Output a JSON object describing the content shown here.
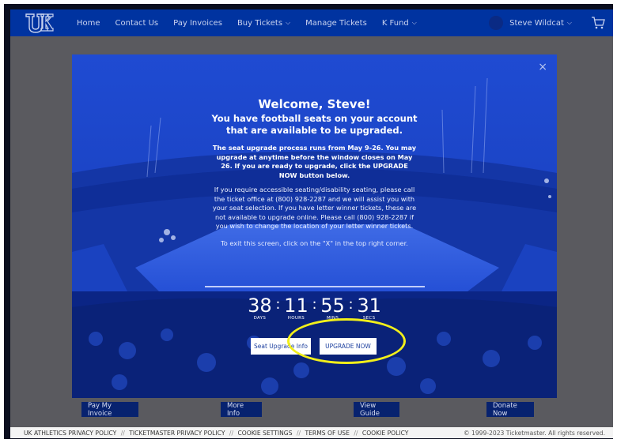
{
  "nav": {
    "items": [
      {
        "label": "Home",
        "dropdown": false
      },
      {
        "label": "Contact Us",
        "dropdown": false
      },
      {
        "label": "Pay Invoices",
        "dropdown": false
      },
      {
        "label": "Buy Tickets",
        "dropdown": true
      },
      {
        "label": "Manage Tickets",
        "dropdown": false
      },
      {
        "label": "K Fund",
        "dropdown": true
      }
    ],
    "user_name": "Steve Wildcat",
    "chevron": "⌵"
  },
  "modal": {
    "close": "×",
    "welcome": "Welcome, Steve!",
    "available": "You have football seats on your account that are available to be upgraded.",
    "para1": "The seat upgrade process runs from May 9-26. You may upgrade at anytime before the window closes on May 26. If you are ready to upgrade, click the UPGRADE NOW button below.",
    "para2": "If you require accessible seating/disability seating, please call the ticket office at (800) 928-2287 and we will assist you with your seat selection. If you have letter winner tickets, these are not available to upgrade online. Please call (800) 928-2287 if you wish to change the location of your letter winner tickets.",
    "para3": "To exit this screen, click on the \"X\" in the top right corner.",
    "countdown": {
      "days": "38",
      "days_label": "DAYS",
      "hours": "11",
      "hours_label": "HOURS",
      "mins": "55",
      "mins_label": "MINS",
      "secs": "31",
      "secs_label": "SECS",
      "separator": ":"
    },
    "seat_info_button": "Seat Upgrade Info",
    "upgrade_button": "UPGRADE NOW"
  },
  "bottom_buttons": [
    "Pay My Invoice",
    "More Info",
    "View Guide",
    "Donate Now"
  ],
  "footer": {
    "links": [
      "UK ATHLETICS PRIVACY POLICY",
      "TICKETMASTER PRIVACY POLICY",
      "COOKIE SETTINGS",
      "TERMS OF USE",
      "COOKIE POLICY"
    ],
    "separator": "//",
    "copyright": "© 1999-2023 Ticketmaster. All rights reserved."
  },
  "colors": {
    "nav_bg": "#0033a0",
    "modal_blue": "#1a3fc4",
    "button_navy": "#07226f",
    "highlight": "#f2ef1a"
  },
  "icons": [
    "uk-logo-icon",
    "chevron-down-icon",
    "avatar-icon",
    "cart-icon",
    "close-icon"
  ]
}
